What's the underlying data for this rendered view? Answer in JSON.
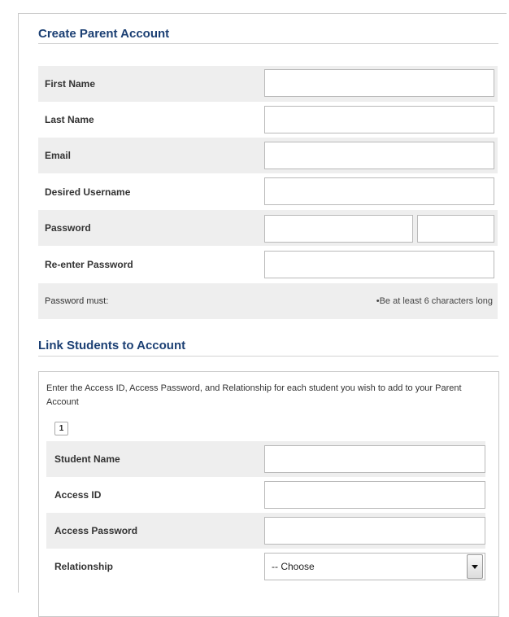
{
  "section_create": {
    "title": "Create Parent Account"
  },
  "fields": [
    {
      "label": "First Name"
    },
    {
      "label": "Last Name"
    },
    {
      "label": "Email"
    },
    {
      "label": "Desired Username"
    },
    {
      "label": "Password"
    },
    {
      "label": "Re-enter Password"
    }
  ],
  "password_rules": {
    "label": "Password must:",
    "rule": "•Be at least 6 characters long"
  },
  "section_link": {
    "title": "Link Students to Account",
    "description": "Enter the Access ID, Access Password, and Relationship for each student you wish to add to your Parent Account",
    "tab_number": "1",
    "fields": [
      {
        "label": "Student Name"
      },
      {
        "label": "Access ID"
      },
      {
        "label": "Access Password"
      },
      {
        "label": "Relationship"
      }
    ],
    "relationship_selected": "-- Choose"
  },
  "icons": {
    "select_arrow": "chevron-down-icon"
  }
}
